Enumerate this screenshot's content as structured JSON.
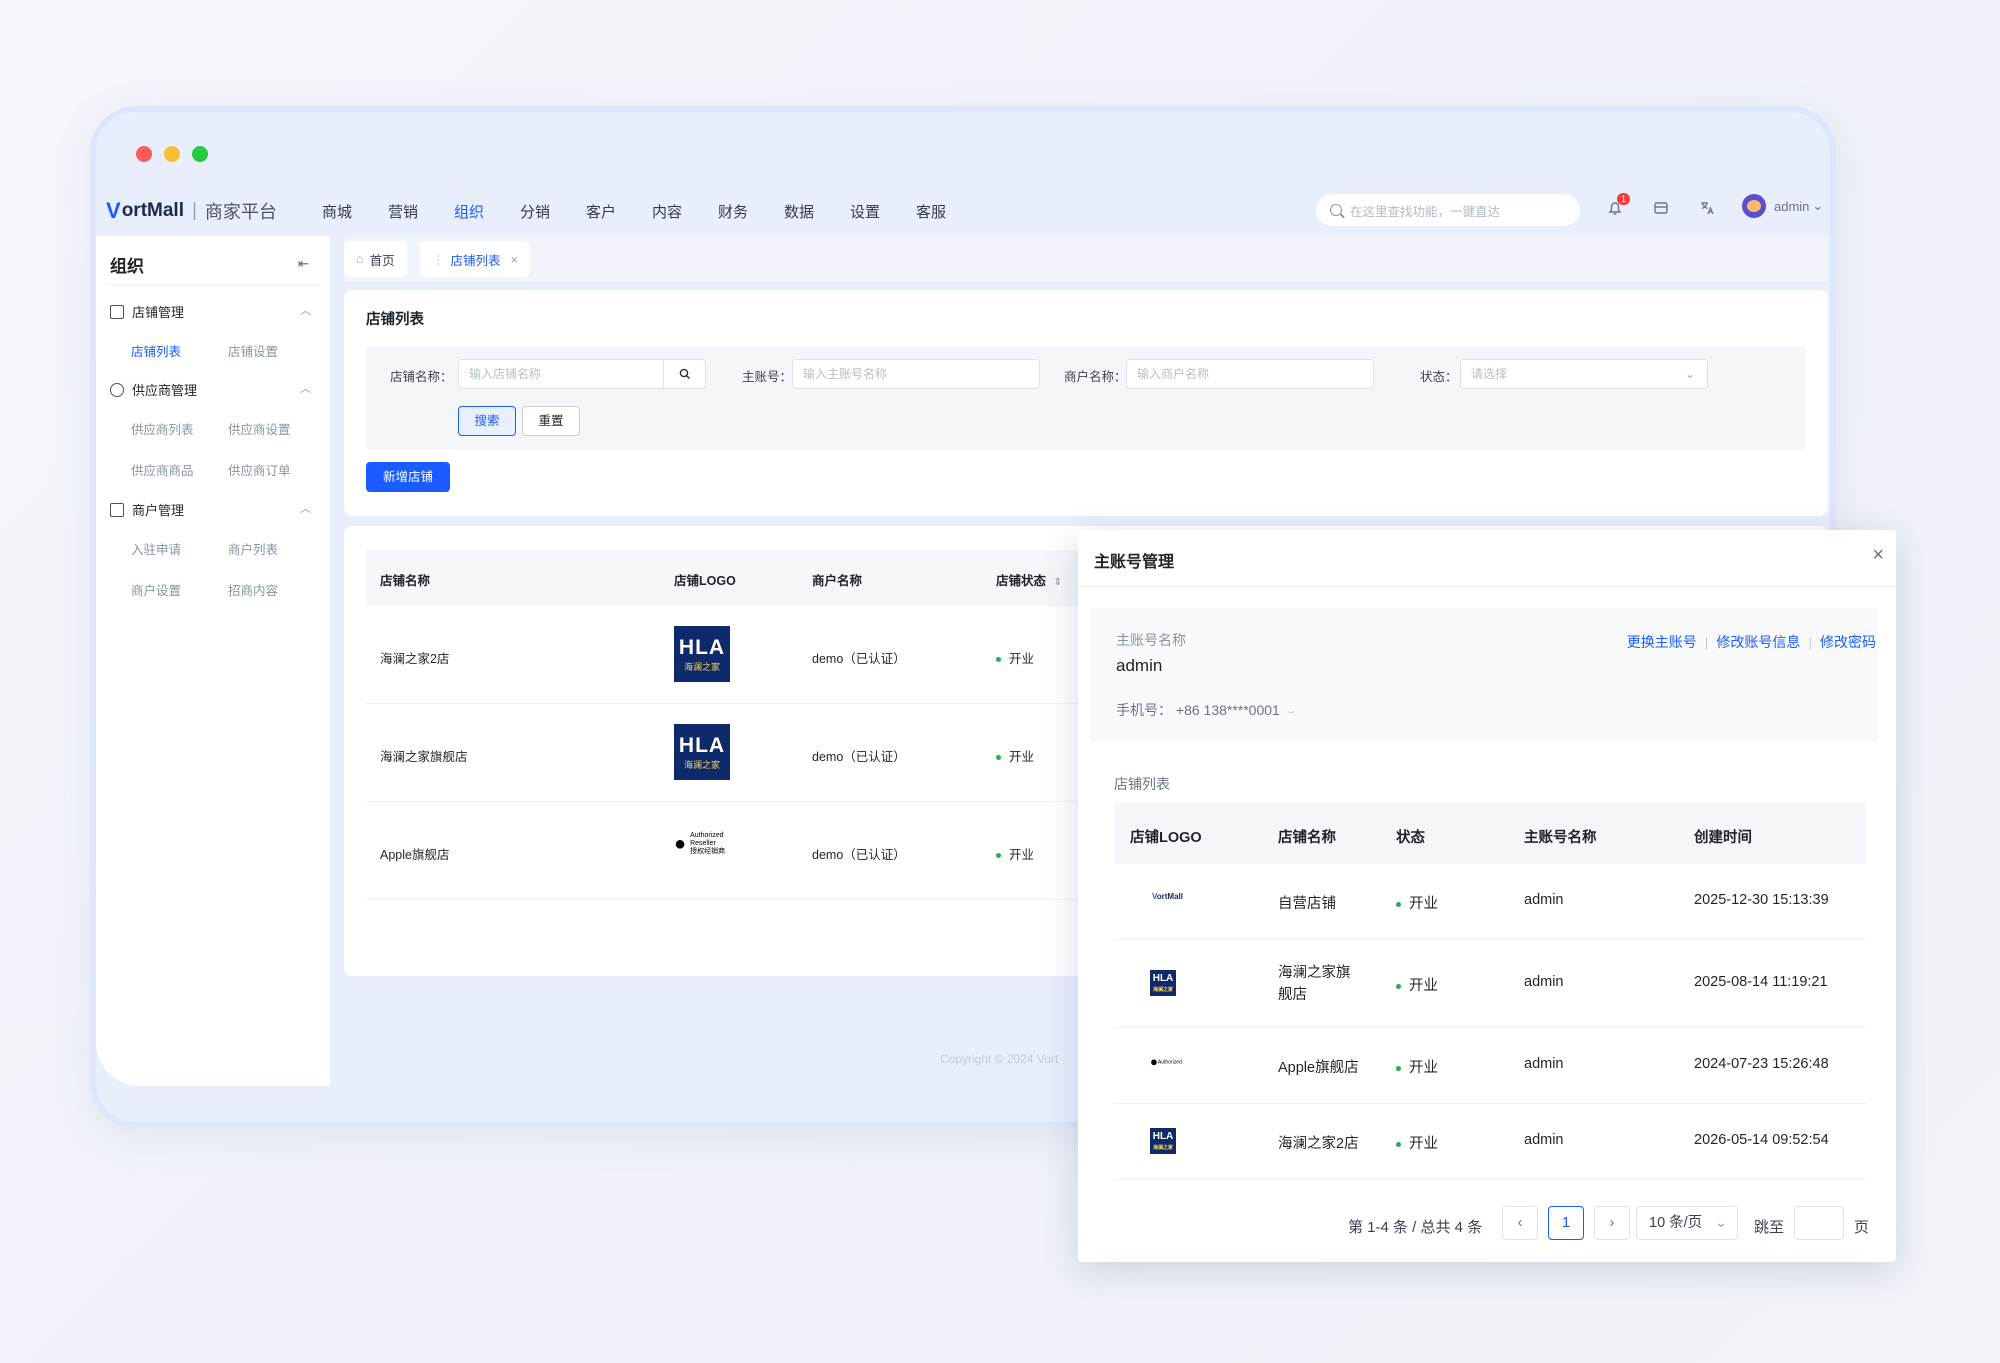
{
  "window": {
    "dots": [
      "#fc5b57",
      "#f6be36",
      "#27c93f"
    ]
  },
  "brand": {
    "logo_mark": "V",
    "logo_text": "ortMall",
    "separator": "|",
    "subtitle": "商家平台"
  },
  "nav": [
    "商城",
    "营销",
    "组织",
    "分销",
    "客户",
    "内容",
    "财务",
    "数据",
    "设置",
    "客服"
  ],
  "nav_active": "组织",
  "search": {
    "placeholder": "在这里查找功能，一键直达"
  },
  "header_tools": {
    "badge": "1"
  },
  "user": {
    "name": "admin",
    "caret": "⌄"
  },
  "sidebar": {
    "title": "组织",
    "collapse_icon": "⇤",
    "groups": [
      {
        "label": "店铺管理",
        "items": [
          "店铺列表",
          "店铺设置"
        ]
      },
      {
        "label": "供应商管理",
        "items": [
          "供应商列表",
          "供应商设置",
          "供应商商品",
          "供应商订单"
        ]
      },
      {
        "label": "商户管理",
        "items": [
          "入驻申请",
          "商户列表",
          "商户设置",
          "招商内容"
        ]
      }
    ]
  },
  "tabs": {
    "home": "首页",
    "current": "店铺列表",
    "close": "×"
  },
  "list_page": {
    "title": "店铺列表",
    "filters": {
      "shop_name_label": "店铺名称：",
      "shop_name_placeholder": "输入店铺名称",
      "account_label": "主账号：",
      "account_placeholder": "输入主账号名称",
      "merchant_label": "商户名称：",
      "merchant_placeholder": "输入商户名称",
      "status_label": "状态：",
      "status_placeholder": "请选择"
    },
    "search_button": "搜索",
    "reset_button": "重置",
    "add_button": "新增店铺",
    "columns": [
      "店铺名称",
      "店铺LOGO",
      "商户名称",
      "店铺状态"
    ],
    "rows": [
      {
        "name": "海澜之家2店",
        "logo": "HLA",
        "merchant": "demo（已认证）",
        "status": "开业"
      },
      {
        "name": "海澜之家旗舰店",
        "logo": "HLA",
        "merchant": "demo（已认证）",
        "status": "开业"
      },
      {
        "name": "Apple旗舰店",
        "logo": "Apple",
        "merchant": "demo（已认证）",
        "status": "开业"
      }
    ]
  },
  "logos": {
    "hla_text": "HLA",
    "hla_sub": "海澜之家",
    "apple_line1": "Authorized",
    "apple_line2": "Reseller",
    "apple_line3": "授权经销商",
    "vortmall_mini": "ortMall"
  },
  "copyright": "Copyright © 2024 Vort",
  "modal": {
    "title": "主账号管理",
    "account_label": "主账号名称",
    "account_name": "admin",
    "phone_label": "手机号：",
    "phone_value": "+86  138****0001",
    "links": [
      "更换主账号",
      "修改账号信息",
      "修改密码"
    ],
    "shop_list_title": "店铺列表",
    "columns": [
      "店铺LOGO",
      "店铺名称",
      "状态",
      "主账号名称",
      "创建时间"
    ],
    "rows": [
      {
        "logo": "VortMall",
        "name": "自营店铺",
        "status": "开业",
        "account": "admin",
        "created": "2025-12-30 15:13:39"
      },
      {
        "logo": "HLA",
        "name": "海澜之家旗舰店",
        "status": "开业",
        "account": "admin",
        "created": "2025-08-14 11:19:21"
      },
      {
        "logo": "Apple",
        "name": "Apple旗舰店",
        "status": "开业",
        "account": "admin",
        "created": "2024-07-23 15:26:48"
      },
      {
        "logo": "HLA",
        "name": "海澜之家2店",
        "status": "开业",
        "account": "admin",
        "created": "2026-05-14 09:52:54"
      }
    ],
    "pagination": {
      "summary": "第 1-4 条 / 总共 4 条",
      "current_page": "1",
      "page_size": "10 条/页",
      "jump_label": "跳至",
      "page_suffix": "页",
      "prev": "‹",
      "next": "›"
    }
  }
}
